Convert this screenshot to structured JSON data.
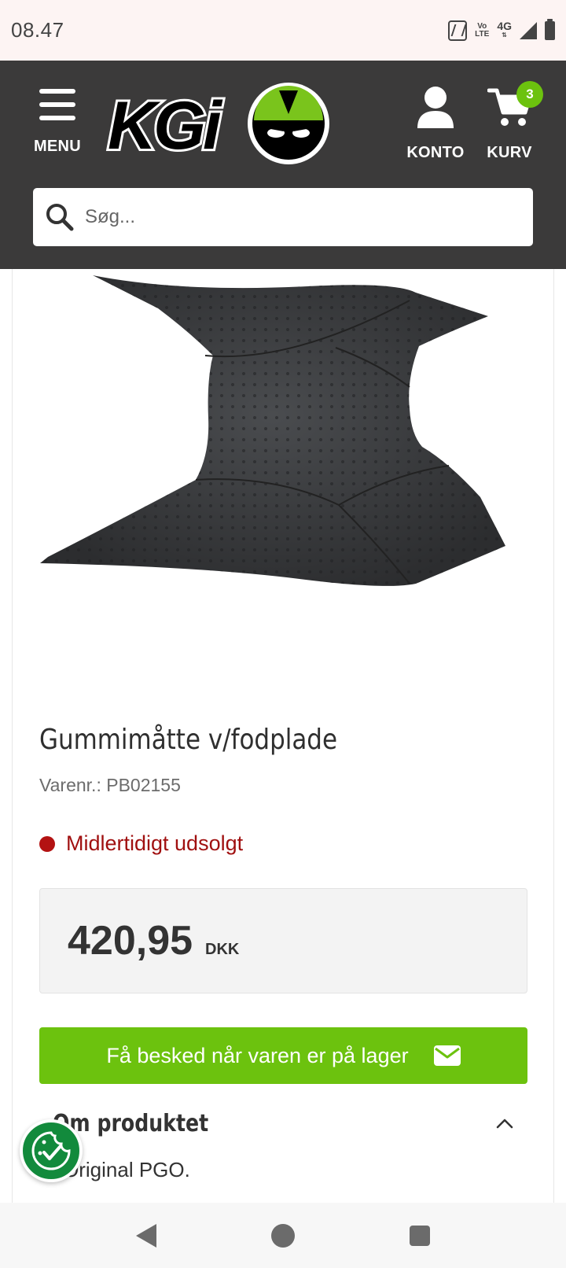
{
  "status_bar": {
    "time": "08.47",
    "volte_top": "Vo",
    "volte_bottom": "LTE",
    "network": "4G"
  },
  "header": {
    "menu_label": "MENU",
    "logo_text": "KGi",
    "account_label": "KONTO",
    "cart_label": "KURV",
    "cart_count": "3",
    "search_placeholder": "Søg..."
  },
  "product": {
    "title": "Gummimåtte v/fodplade",
    "sku": "Varenr.: PB02155",
    "stock_status": "Midlertidigt udsolgt",
    "price": "420,95",
    "currency": "DKK",
    "notify_button": "Få besked når varen er på lager",
    "about_title": "Om produktet",
    "about_text": "Original PGO."
  },
  "colors": {
    "header_bg": "#3b3a3a",
    "accent_green": "#6cc20e",
    "out_of_stock_red": "#b31212",
    "cookie_green": "#128a3c"
  },
  "icons": {
    "menu": "hamburger-icon",
    "account": "user-icon",
    "cart": "cart-icon",
    "search": "search-icon",
    "mail": "envelope-icon",
    "cookie": "cookie-check-icon"
  }
}
